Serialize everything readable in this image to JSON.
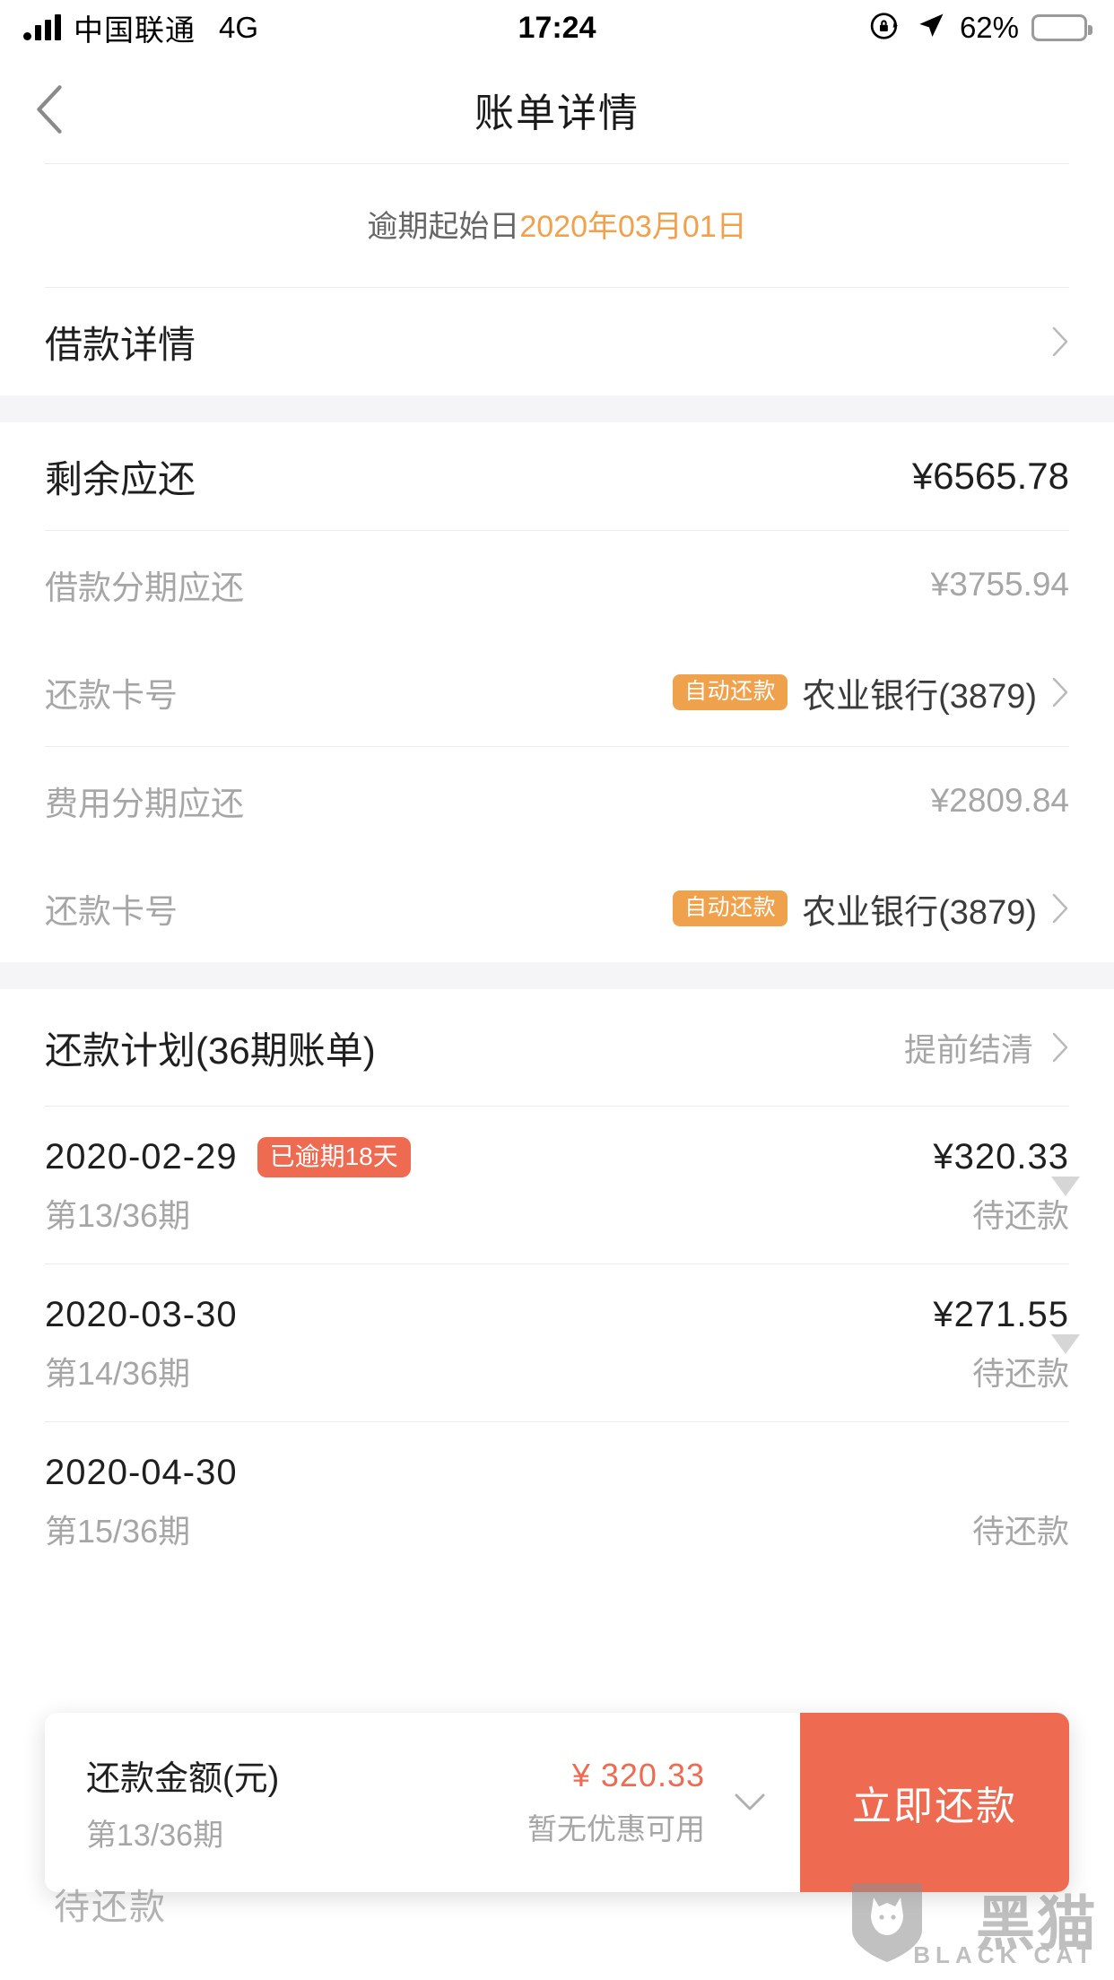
{
  "statusbar": {
    "carrier": "中国联通",
    "network": "4G",
    "time": "17:24",
    "battery_percent": "62%",
    "battery_level": 62,
    "signal_icon": "signal-bars-icon",
    "rotation_lock_icon": "rotation-lock-icon",
    "location_icon": "location-arrow-icon",
    "battery_icon": "battery-icon",
    "battery_color": "#F7CE46"
  },
  "navbar": {
    "back_icon": "chevron-left-icon",
    "title": "账单详情"
  },
  "overdue_banner": {
    "label": "逾期起始日",
    "date": "2020年03月01日",
    "date_color": "#F2A049"
  },
  "loan_detail_row": {
    "label": "借款详情",
    "chevron_icon": "chevron-right-icon"
  },
  "summary": {
    "total": {
      "label": "剩余应还",
      "value": "¥6565.78"
    },
    "groups": [
      {
        "amount_label": "借款分期应还",
        "amount_value": "¥3755.94",
        "card_label": "还款卡号",
        "card_badge": "自动还款",
        "card_value": "农业银行(3879)",
        "chevron_icon": "chevron-right-icon"
      },
      {
        "amount_label": "费用分期应还",
        "amount_value": "¥2809.84",
        "card_label": "还款卡号",
        "card_badge": "自动还款",
        "card_value": "农业银行(3879)",
        "chevron_icon": "chevron-right-icon"
      }
    ],
    "badge_color": "#EFA14B"
  },
  "plan": {
    "title": "还款计划(36期账单)",
    "action": "提前结清",
    "chevron_icon": "chevron-right-icon",
    "installments": [
      {
        "date": "2020-02-29",
        "late_badge": "已逾期18天",
        "amount": "¥320.33",
        "term": "第13/36期",
        "status": "待还款",
        "caret_icon": "caret-down-icon"
      },
      {
        "date": "2020-03-30",
        "late_badge": "",
        "amount": "¥271.55",
        "term": "第14/36期",
        "status": "待还款",
        "caret_icon": "caret-down-icon"
      },
      {
        "date": "2020-04-30",
        "late_badge": "",
        "amount": "",
        "term": "第15/36期",
        "status": "待还款",
        "caret_icon": "caret-down-icon"
      }
    ],
    "late_badge_color": "#EE6B52"
  },
  "floatbar": {
    "title": "还款金额(元)",
    "term": "第13/36期",
    "amount": "¥ 320.33",
    "promo": "暂无优惠可用",
    "expand_icon": "chevron-down-icon",
    "button_label": "立即还款",
    "button_color": "#EE6B52",
    "amount_color": "#EE6B52"
  },
  "watermark": {
    "overlay_text": "待还款",
    "brand_cn": "黑猫",
    "brand_en": "BLACK CAT",
    "logo_icon": "black-cat-shield-icon"
  }
}
